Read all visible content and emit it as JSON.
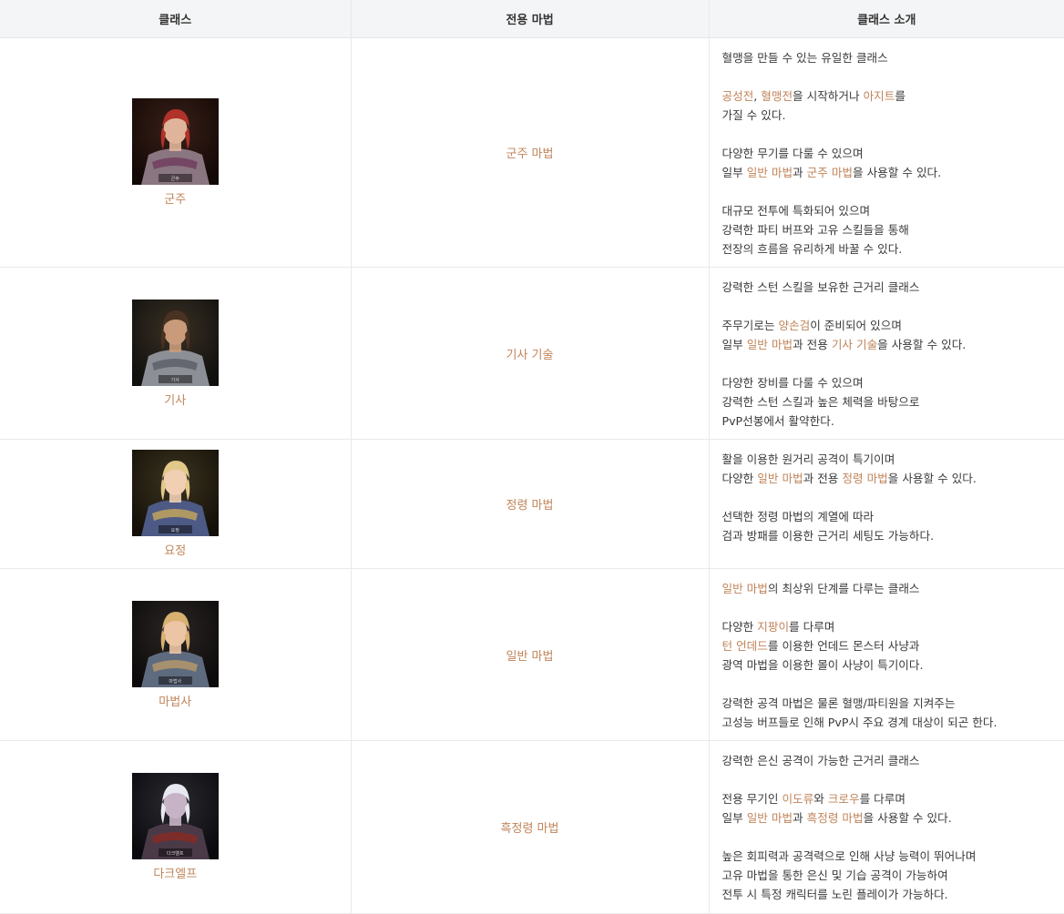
{
  "header": {
    "col_class": "클래스",
    "col_magic": "전용 마법",
    "col_intro": "클래스 소개"
  },
  "accent_color": "#c0845a",
  "rows": [
    {
      "name": "군주",
      "portrait_label": "군주",
      "magic": "군주 마법",
      "height": 252,
      "desc": [
        [
          [
            "혈맹을 만들 수 있는 유일한 클래스"
          ]
        ],
        [
          [
            "공성전",
            "h"
          ],
          [
            ", "
          ],
          [
            "혈맹전",
            "h"
          ],
          [
            "을 시작하거나 "
          ],
          [
            "아지트",
            "h"
          ],
          [
            "를"
          ],
          [
            "\n"
          ],
          [
            "가질 수 있다."
          ]
        ],
        [
          [
            "다양한 무기를 다룰 수 있으며"
          ],
          [
            "\n"
          ],
          [
            "일부 "
          ],
          [
            "일반 마법",
            "h"
          ],
          [
            "과 "
          ],
          [
            "군주 마법",
            "h"
          ],
          [
            "을 사용할 수 있다."
          ]
        ],
        [
          [
            "대규모 전투에 특화되어 있으며"
          ],
          [
            "\n"
          ],
          [
            "강력한 파티 버프와 고유 스킬들을 통해"
          ],
          [
            "\n"
          ],
          [
            "전장의 흐름을 유리하게 바꿀 수 있다."
          ]
        ]
      ]
    },
    {
      "name": "기사",
      "portrait_label": "기사",
      "magic": "기사 기술",
      "height": 189,
      "desc": [
        [
          [
            "강력한 스턴 스킬을 보유한 근거리 클래스"
          ]
        ],
        [
          [
            "주무기로는 "
          ],
          [
            "양손검",
            "h"
          ],
          [
            "이 준비되어 있으며"
          ],
          [
            "\n"
          ],
          [
            "일부 "
          ],
          [
            "일반 마법",
            "h"
          ],
          [
            "과 전용 "
          ],
          [
            "기사 기술",
            "h"
          ],
          [
            "을 사용할 수 있다."
          ]
        ],
        [
          [
            "다양한 장비를 다룰 수 있으며"
          ],
          [
            "\n"
          ],
          [
            "강력한 스턴 스킬과 높은 체력을 바탕으로"
          ],
          [
            "\n"
          ],
          [
            "PvP선봉에서 활약한다."
          ]
        ]
      ]
    },
    {
      "name": "요정",
      "portrait_label": "요정",
      "magic": "정령 마법",
      "height": 142,
      "desc": [
        [
          [
            "활을 이용한 원거리 공격이 특기이며"
          ],
          [
            "\n"
          ],
          [
            "다양한 "
          ],
          [
            "일반 마법",
            "h"
          ],
          [
            "과 전용 "
          ],
          [
            "정령 마법",
            "h"
          ],
          [
            "을 사용할 수 있다."
          ]
        ],
        [
          [
            "선택한 정령 마법의 계열에 따라"
          ],
          [
            "\n"
          ],
          [
            "검과 방패를 이용한 근거리 세팅도 가능하다."
          ]
        ]
      ]
    },
    {
      "name": "마법사",
      "portrait_label": "마법사",
      "magic": "일반 마법",
      "height": 189,
      "desc": [
        [
          [
            "일반 마법",
            "h"
          ],
          [
            "의 최상위 단계를 다루는 클래스"
          ]
        ],
        [
          [
            "다양한 "
          ],
          [
            "지팡이",
            "h"
          ],
          [
            "를 다루며"
          ],
          [
            "\n"
          ],
          [
            "턴 언데드",
            "h"
          ],
          [
            "를 이용한 언데드 몬스터 사냥과"
          ],
          [
            "\n"
          ],
          [
            "광역 마법을 이용한 몰이 사냥이 특기이다."
          ]
        ],
        [
          [
            "강력한 공격 마법은 물론 혈맹/파티원을 지켜주는"
          ],
          [
            "\n"
          ],
          [
            "고성능 버프들로 인해 PvP시 주요 경계 대상이 되곤 한다."
          ]
        ]
      ]
    },
    {
      "name": "다크엘프",
      "portrait_label": "다크엘프",
      "magic": "흑정령 마법",
      "height": 190,
      "desc": [
        [
          [
            "강력한 은신 공격이 가능한 근거리 클래스"
          ]
        ],
        [
          [
            "전용 무기인 "
          ],
          [
            "이도류",
            "h"
          ],
          [
            "와 "
          ],
          [
            "크로우",
            "h"
          ],
          [
            "를 다루며"
          ],
          [
            "\n"
          ],
          [
            "일부 "
          ],
          [
            "일반 마법",
            "h"
          ],
          [
            "과 "
          ],
          [
            "흑정령 마법",
            "h"
          ],
          [
            "을 사용할 수 있다."
          ]
        ],
        [
          [
            "높은 회피력과 공격력으로 인해 사냥 능력이 뛰어나며"
          ],
          [
            "\n"
          ],
          [
            "고유 마법을 통한 은신 및 기습 공격이 가능하여"
          ],
          [
            "\n"
          ],
          [
            "전투 시 특정 캐릭터를 노린 플레이가 가능하다."
          ]
        ]
      ]
    }
  ]
}
